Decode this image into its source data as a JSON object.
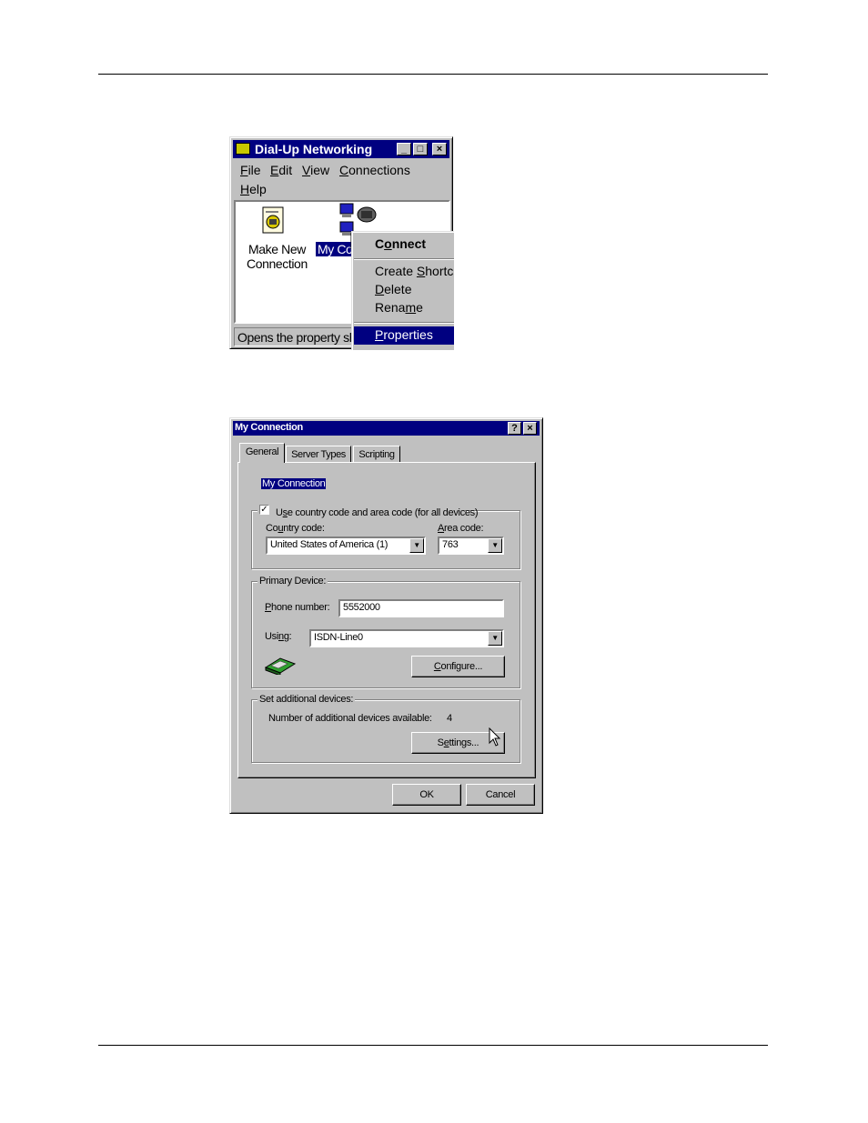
{
  "dun": {
    "title": "Dial-Up Networking",
    "menu": [
      {
        "label": "File",
        "key": "F",
        "rest": "ile"
      },
      {
        "label": "Edit",
        "key": "E",
        "rest": "dit"
      },
      {
        "label": "View",
        "key": "V",
        "rest": "iew"
      },
      {
        "label": "Connections",
        "key": "C",
        "rest": "onnections"
      },
      {
        "label": "Help",
        "key": "H",
        "rest": "elp"
      }
    ],
    "icons": {
      "make_new_line1": "Make New",
      "make_new_line2": "Connection",
      "my_connection": "My Co"
    },
    "status": "Opens the property sh",
    "context_menu": {
      "connect": {
        "pre": "C",
        "key": "o",
        "post": "nnect"
      },
      "create_shortcut": {
        "pre": "Create ",
        "key": "S",
        "post": "hortcut"
      },
      "delete": {
        "pre": "",
        "key": "D",
        "post": "elete"
      },
      "rename": {
        "pre": "Rena",
        "key": "m",
        "post": "e"
      },
      "properties": {
        "pre": "",
        "key": "P",
        "post": "roperties"
      }
    }
  },
  "props": {
    "title": "My Connection",
    "help_btn": "?",
    "close_btn": "×",
    "tabs": [
      "General",
      "Server Types",
      "Scripting"
    ],
    "name_value": "My Connection",
    "use_country": {
      "pre": "U",
      "key": "s",
      "post": "e country code and area code (for all devices)"
    },
    "country_label": {
      "pre": "Co",
      "key": "u",
      "post": "ntry code:"
    },
    "country_value": "United States of America (1)",
    "area_label": {
      "pre": "",
      "key": "A",
      "post": "rea code:"
    },
    "area_value": "763",
    "primary_device": "Primary Device:",
    "phone_label": {
      "pre": "",
      "key": "P",
      "post": "hone number:"
    },
    "phone_value": "5552000",
    "using_label": {
      "pre": "Usi",
      "key": "n",
      "post": "g:"
    },
    "using_value": "ISDN-Line0",
    "configure_btn": {
      "pre": "",
      "key": "C",
      "post": "onfigure..."
    },
    "additional_group": "Set additional devices:",
    "additional_label": "Number of additional devices available:",
    "additional_count": "4",
    "settings_btn": {
      "pre": "S",
      "key": "e",
      "post": "ttings..."
    },
    "ok": "OK",
    "cancel": "Cancel"
  }
}
